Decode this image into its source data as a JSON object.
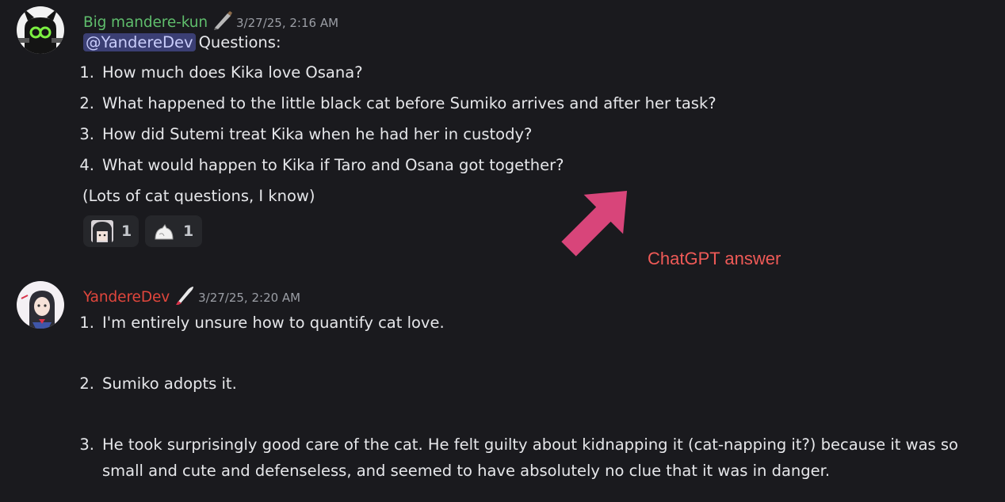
{
  "message1": {
    "username": "Big mandere-kun",
    "username_color": "#5fbd6c",
    "user_icon": "pen-icon",
    "timestamp": "3/27/25, 2:16 AM",
    "mention": "@YandereDev",
    "intro": "Questions:",
    "questions": [
      {
        "num": "1.",
        "text": "How much does Kika love Osana?"
      },
      {
        "num": "2.",
        "text": "What happened to the little black cat before Sumiko arrives  and after her task?"
      },
      {
        "num": "3.",
        "text": "How did Sutemi treat Kika when he had her in custody?"
      },
      {
        "num": "4.",
        "text": "What would happen to Kika if Taro and Osana got together?"
      }
    ],
    "note": "(Lots of cat questions, I know)",
    "reactions": [
      {
        "icon": "anime-girl-emoji",
        "count": "1"
      },
      {
        "icon": "white-cat-emoji",
        "count": "1"
      }
    ]
  },
  "message2": {
    "username": "YandereDev",
    "username_color": "#e0463c",
    "user_icon": "knife-icon",
    "timestamp": "3/27/25, 2:20 AM",
    "answers": [
      {
        "num": "1.",
        "text": "I'm entirely unsure how to quantify cat love."
      },
      {
        "num": "2.",
        "text": "Sumiko adopts it."
      },
      {
        "num": "3.",
        "lines": [
          "He took surprisingly good care of the cat. He felt guilty about kidnapping it (cat-napping it?) because it was so",
          "small and cute and defenseless, and seemed to have absolutely no clue that it was in danger."
        ]
      }
    ]
  },
  "annotation": {
    "label": "ChatGPT answer",
    "arrow_color": "#d8457a",
    "label_color": "#ef5a57"
  }
}
